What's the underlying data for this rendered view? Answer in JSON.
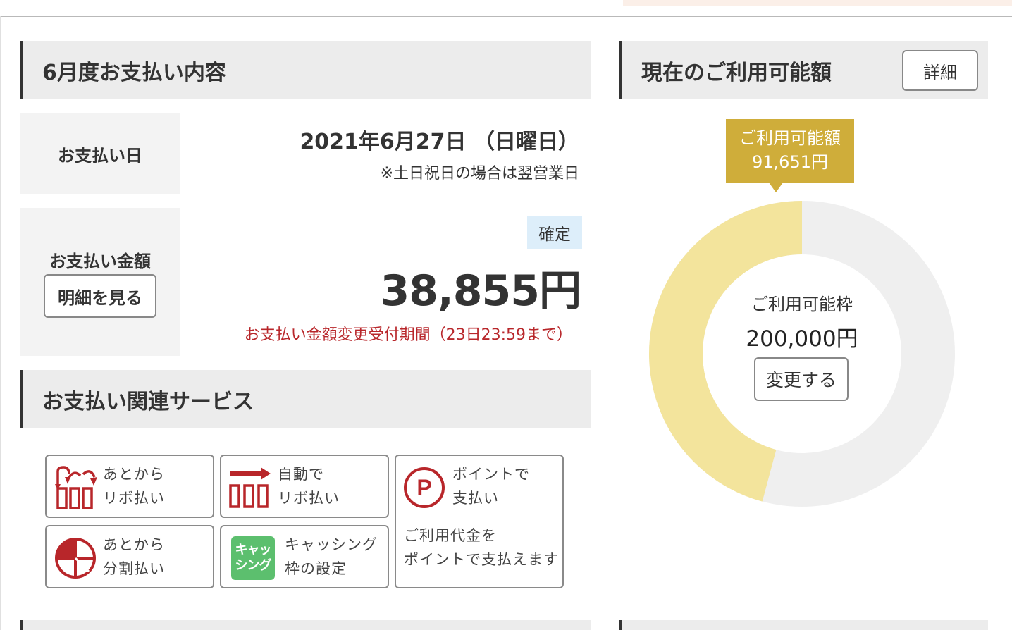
{
  "payment": {
    "title": "6月度お支払い内容",
    "date_label": "お支払い日",
    "date_value": "2021年6月27日 （日曜日）",
    "date_note": "※土日祝日の場合は翌営業日",
    "amount_label": "お支払い金額",
    "detail_button": "明細を見る",
    "status_badge": "確定",
    "amount_value": "38,855円",
    "change_period": "お支払い金額変更受付期間（23日23:59まで）"
  },
  "services": {
    "title": "お支払い関連サービス",
    "items": [
      {
        "line1": "あとから",
        "line2": "リボ払い",
        "icon": "later-revolving-icon"
      },
      {
        "line1": "自動で",
        "line2": "リボ払い",
        "icon": "auto-revolving-icon"
      },
      {
        "line1": "ポイントで",
        "line2": "支払い",
        "icon": "point-p-icon",
        "desc1": "ご利用代金を",
        "desc2": "ポイントで支払えます"
      },
      {
        "line1": "あとから",
        "line2": "分割払い",
        "icon": "installment-icon"
      },
      {
        "line1": "キャッシング",
        "line2": "枠の設定",
        "icon": "cashing-icon",
        "icon_text1": "キャッ",
        "icon_text2": "シング"
      }
    ]
  },
  "credit": {
    "title": "現在のご利用可能額",
    "detail_button": "詳細",
    "available_label": "ご利用可能額",
    "available_value": "91,651円",
    "limit_label": "ご利用可能枠",
    "limit_value": "200,000円",
    "change_button": "変更する",
    "available_fraction": 0.458,
    "colors": {
      "available": "#f3e49c",
      "used": "#efefef",
      "tooltip": "#cfad3a",
      "accent_red": "#b8262a",
      "badge": "#ddeefa",
      "cashing_green": "#5cbf6e"
    }
  }
}
